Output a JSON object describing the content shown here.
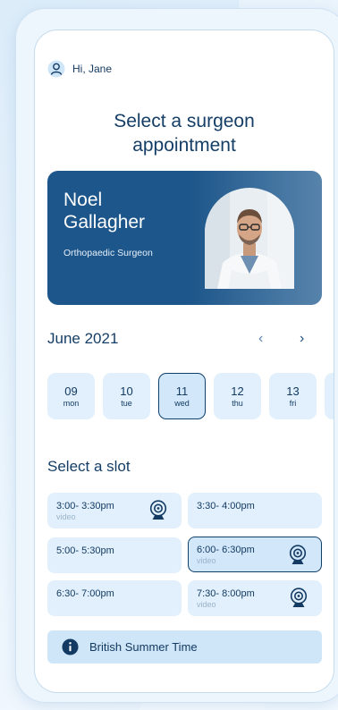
{
  "greeting": "Hi, Jane",
  "title_line1": "Select a surgeon",
  "title_line2": "appointment",
  "surgeon": {
    "first_name": "Noel",
    "last_name": "Gallagher",
    "role": "Orthopaedic Surgeon"
  },
  "calendar": {
    "month": "June 2021",
    "prev_icon": "chevron-left-icon",
    "next_icon": "chevron-right-icon",
    "days": [
      {
        "num": "09",
        "dow": "mon"
      },
      {
        "num": "10",
        "dow": "tue"
      },
      {
        "num": "11",
        "dow": "wed",
        "selected": true
      },
      {
        "num": "12",
        "dow": "thu"
      },
      {
        "num": "13",
        "dow": "fri"
      }
    ]
  },
  "slots_heading": "Select a slot",
  "slots": [
    {
      "time": "3:00- 3:30pm",
      "tag": "video"
    },
    {
      "time": "3:30- 4:00pm",
      "tag": ""
    },
    {
      "time": "5:00- 5:30pm",
      "tag": ""
    },
    {
      "time": "6:00- 6:30pm",
      "tag": "video",
      "selected": true
    },
    {
      "time": "6:30- 7:00pm",
      "tag": ""
    },
    {
      "time": "7:30- 8:00pm",
      "tag": "video"
    }
  ],
  "timezone": "British Summer Time",
  "colors": {
    "primary": "#1d568a",
    "chip": "#e1f0fc",
    "selected_border": "#0f3f6b"
  }
}
